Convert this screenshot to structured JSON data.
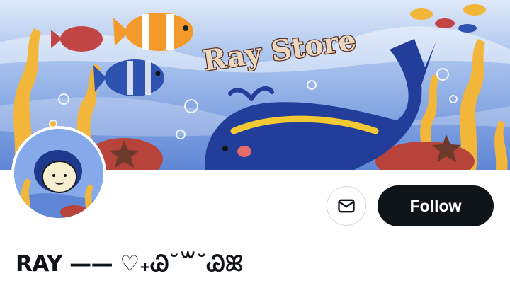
{
  "banner": {
    "store_title": "Ray Store",
    "colors": {
      "sky": "#cfe0f7",
      "sea": "#6b93dd",
      "whale": "#233d9a",
      "coral": "#f2b63a"
    }
  },
  "profile": {
    "display_name": "RAY —— ♡₊Ꮚ˘꒳˘Ꮚꕤ"
  },
  "actions": {
    "follow_label": "Follow",
    "message_icon": "envelope-icon"
  }
}
